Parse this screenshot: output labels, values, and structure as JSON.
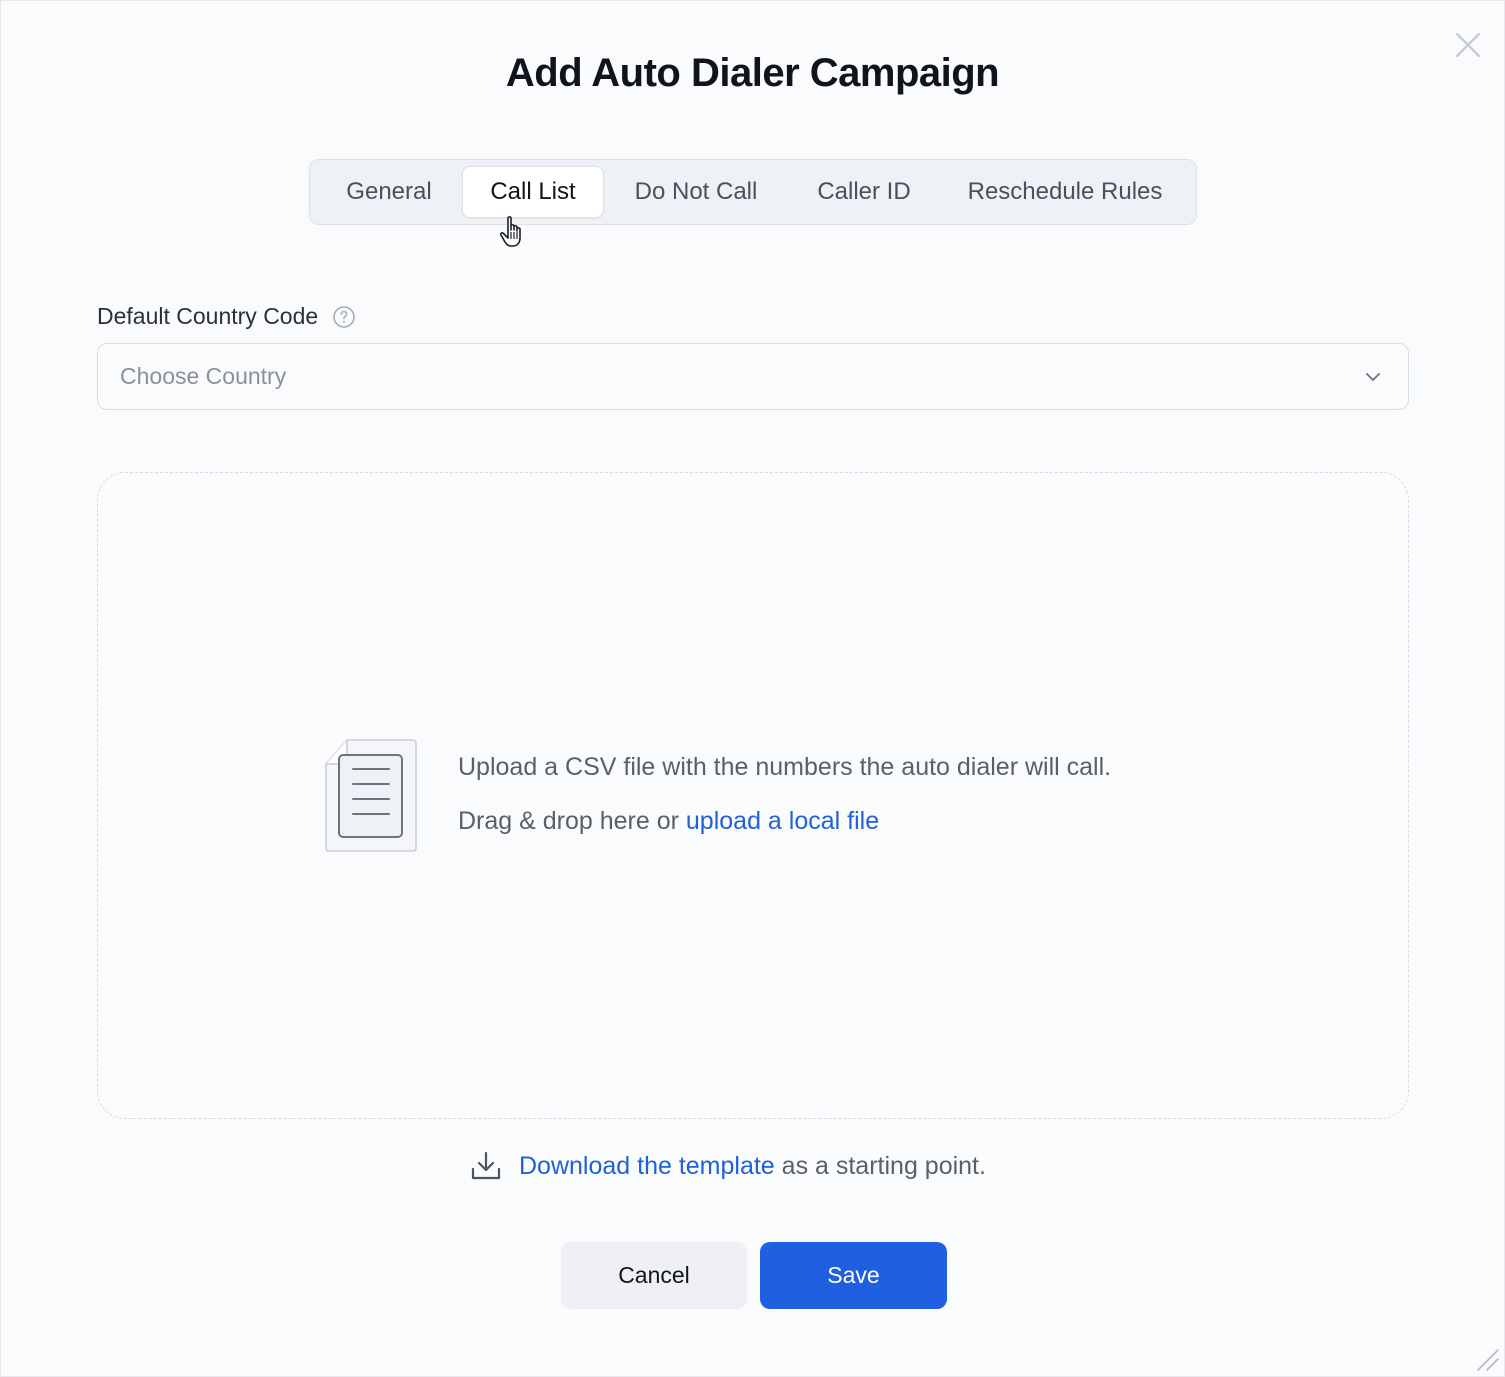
{
  "dialog": {
    "title": "Add Auto Dialer Campaign"
  },
  "tabs": [
    {
      "label": "General",
      "active": false
    },
    {
      "label": "Call List",
      "active": true
    },
    {
      "label": "Do Not Call",
      "active": false
    },
    {
      "label": "Caller ID",
      "active": false
    },
    {
      "label": "Reschedule Rules",
      "active": false
    }
  ],
  "country_field": {
    "label": "Default Country Code",
    "placeholder": "Choose Country",
    "help_icon": "question-circle-icon",
    "dropdown_icon": "chevron-down-icon"
  },
  "upload": {
    "line1": "Upload a CSV file with the numbers the auto dialer will call.",
    "line2_prefix": "Drag & drop here or ",
    "line2_link": "upload a local file",
    "icon": "document-icon"
  },
  "template": {
    "icon": "download-icon",
    "link": "Download the template",
    "suffix": " as a starting point."
  },
  "actions": {
    "cancel": "Cancel",
    "save": "Save"
  },
  "colors": {
    "accent": "#1f5fe0",
    "link": "#2161d8"
  }
}
